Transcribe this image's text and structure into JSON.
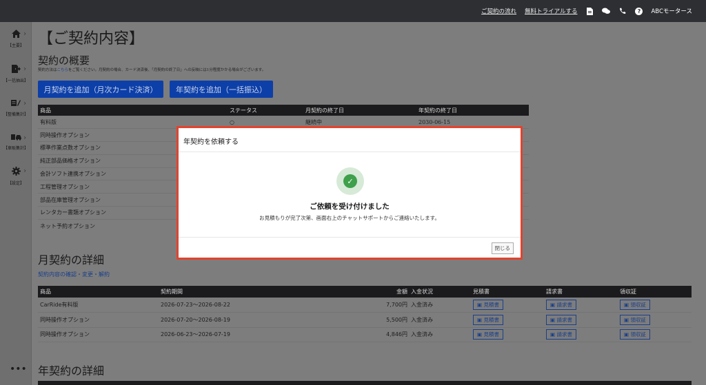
{
  "topbar": {
    "links": [
      "ご契約の流れ",
      "無料トライアルする"
    ],
    "brand": "ABCモータース",
    "help_glyph": "?",
    "icons": [
      "document-icon",
      "chat-icon",
      "phone-icon",
      "help-icon"
    ]
  },
  "sidebar": {
    "items": [
      {
        "label": "【主要】",
        "icon": "home-icon"
      },
      {
        "label": "【一括抽出】",
        "icon": "export-icon"
      },
      {
        "label": "【整備集計】",
        "icon": "maintenance-icon"
      },
      {
        "label": "【車販集計】",
        "icon": "car-sales-icon"
      },
      {
        "label": "【設定】",
        "icon": "gear-icon"
      }
    ],
    "more": "•••"
  },
  "page": {
    "title": "【ご契約内容】",
    "overview_title": "契約の概要",
    "overview_desc_pre": "契約方法は",
    "overview_desc_link": "こちら",
    "overview_desc_post": "をご覧ください。月契約の場合、カード決済後、「月契約の終了日」への反映には1分程度かかる場合がございます。",
    "add_monthly": "月契約を追加（月次カード決済）",
    "add_yearly": "年契約を追加（一括振込）"
  },
  "plans_table": {
    "headers": [
      "商品",
      "ステータス",
      "月契約の終了日",
      "年契約の終了日"
    ],
    "rows": [
      [
        "有料版",
        "○",
        "継続中",
        "2030-06-15"
      ],
      [
        "同時操作オプション",
        "",
        "",
        ""
      ],
      [
        "標準作業点数オプション",
        "",
        "",
        ""
      ],
      [
        "純正部品価格オプション",
        "",
        "",
        ""
      ],
      [
        "会計ソフト連携オプション",
        "",
        "",
        ""
      ],
      [
        "工程管理オプション",
        "",
        "",
        ""
      ],
      [
        "部品在庫管理オプション",
        "",
        "",
        ""
      ],
      [
        "レンタカー書類オプション",
        "",
        "",
        ""
      ],
      [
        "ネット予約オプション",
        "",
        "",
        ""
      ]
    ]
  },
  "monthly": {
    "title": "月契約の詳細",
    "link": "契約内容の確認・変更・解約",
    "headers": [
      "商品",
      "契約期間",
      "金額",
      "入金状況",
      "見積書",
      "請求書",
      "領収証"
    ],
    "doc_labels": [
      "見積書",
      "請求書",
      "領収証"
    ],
    "rows": [
      {
        "product": "CarRide有料版",
        "period": "2026-07-23〜2026-08-22",
        "amount": "7,700円",
        "status": "入金済み"
      },
      {
        "product": "同時操作オプション",
        "period": "2026-07-20〜2026-08-19",
        "amount": "5,500円",
        "status": "入金済み"
      },
      {
        "product": "同時操作オプション",
        "period": "2026-06-23〜2026-07-19",
        "amount": "4,846円",
        "status": "入金済み"
      }
    ]
  },
  "yearly": {
    "title": "年契約の詳細"
  },
  "modal": {
    "title": "年契約を依頼する",
    "icon": "check-icon",
    "check_glyph": "✓",
    "message": "ご依頼を受け付けました",
    "submessage": "お見積もりが完了次第、画面右上のチャットサポートからご連絡いたします。",
    "close_label": "閉じる",
    "frame_color": "#e2432e",
    "success_color": "#3ea04a"
  }
}
